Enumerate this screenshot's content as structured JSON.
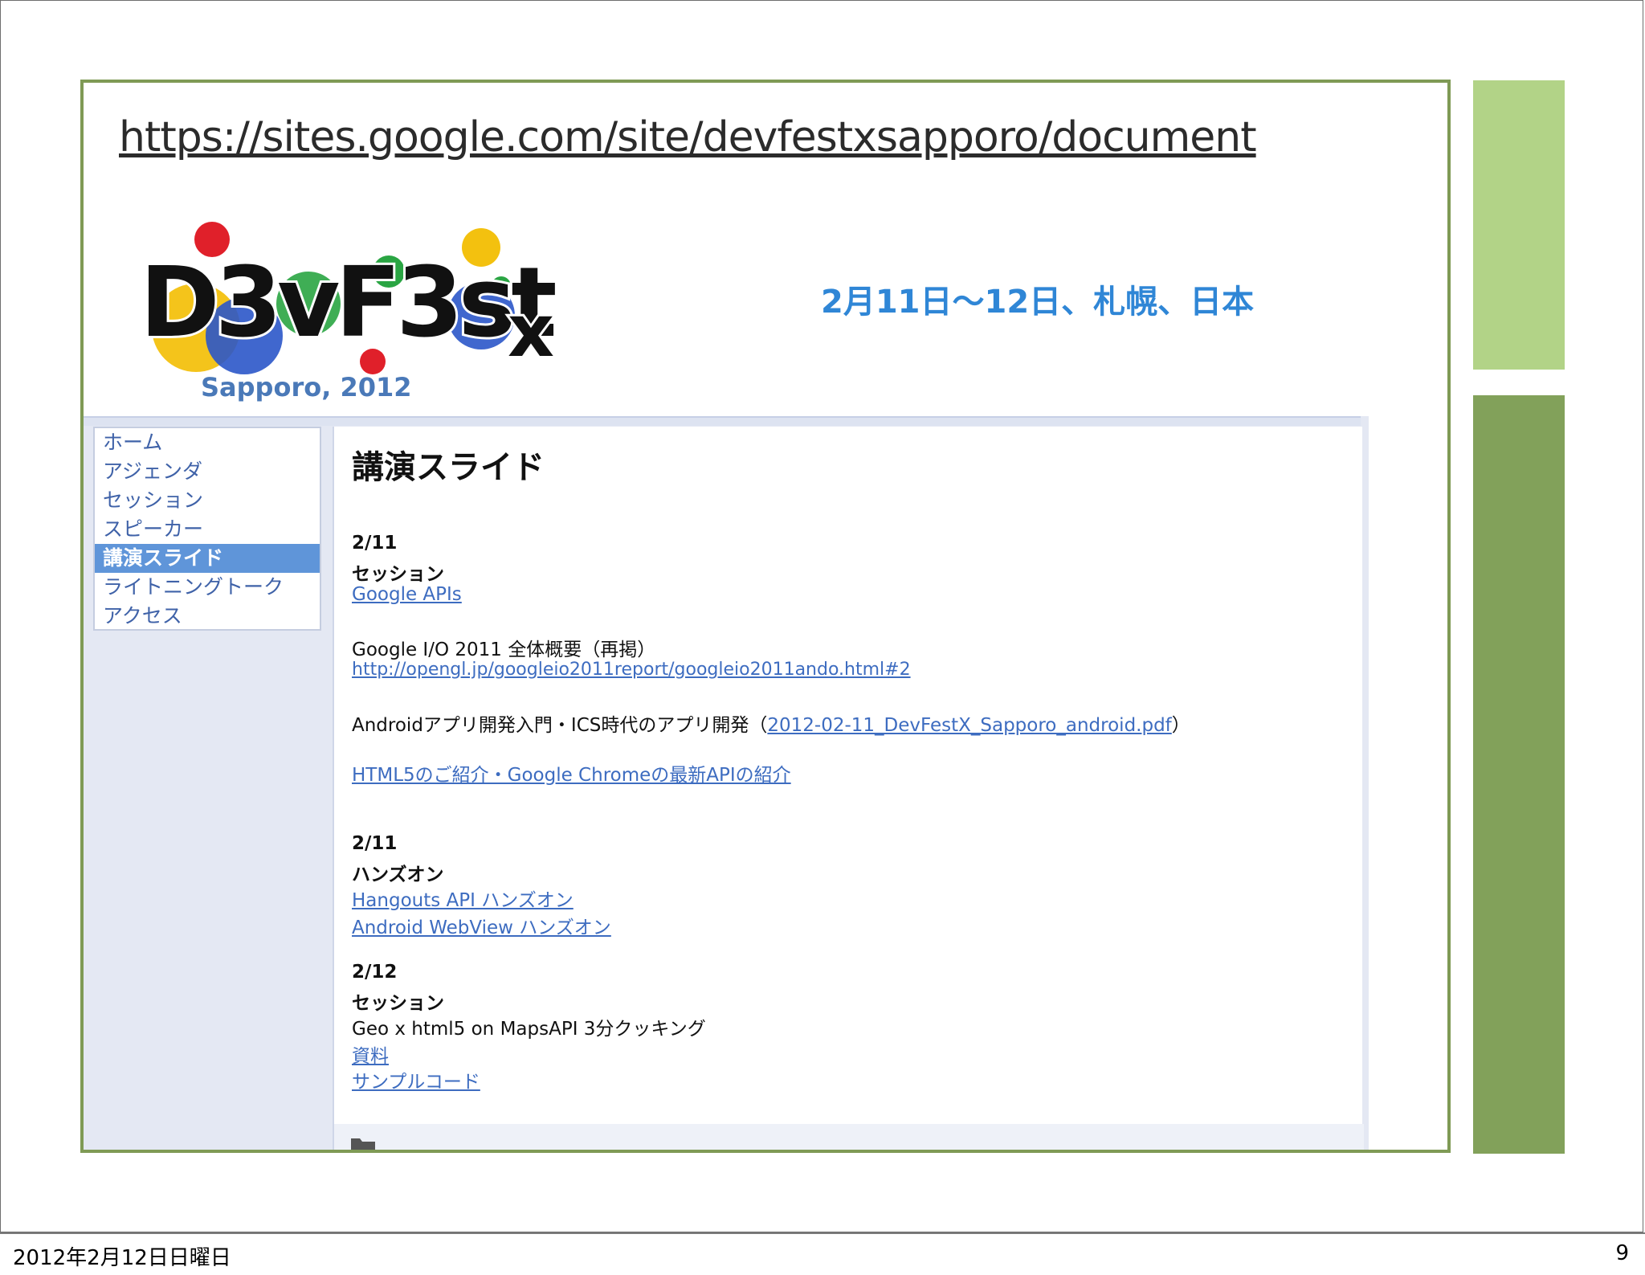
{
  "slide": {
    "url_title": "https://sites.google.com/site/devfestxsapporo/document",
    "footer_date": "2012年2月12日日曜日",
    "page_number": "9",
    "accent_light": "#b2d387",
    "accent_dark": "#82a15a"
  },
  "site": {
    "logo_text": "D3vF3st",
    "logo_x": "x",
    "logo_subtitle": "Sapporo, 2012",
    "event_date": "2月11日〜12日、札幌、日本",
    "nav": [
      {
        "label": "ホーム",
        "active": false
      },
      {
        "label": "アジェンダ",
        "active": false
      },
      {
        "label": "セッション",
        "active": false
      },
      {
        "label": "スピーカー",
        "active": false
      },
      {
        "label": "講演スライド",
        "active": true
      },
      {
        "label": "ライトニングトーク",
        "active": false
      },
      {
        "label": "アクセス",
        "active": false
      }
    ],
    "page_heading": "講演スライド",
    "sections": {
      "s1_date": "2/11",
      "s1_type": "セッション",
      "s1_link": "Google APIs",
      "s1_io_title": "Google I/O 2011 全体概要（再掲）",
      "s1_io_link": "http://opengl.jp/googleio2011report/googleio2011ando.html#2",
      "s1_android_title": "Androidアプリ開発入門・ICS時代のアプリ開発（",
      "s1_android_link": "2012-02-11_DevFestX_Sapporo_android.pdf",
      "s1_android_close": "）",
      "s1_html5_link": "HTML5のご紹介・Google Chromeの最新APIの紹介",
      "s2_date": "2/11",
      "s2_type": "ハンズオン",
      "s2_link1": "Hangouts API ハンズオン",
      "s2_link2": "Android WebView ハンズオン",
      "s3_date": "2/12",
      "s3_type": "セッション",
      "s3_title": "Geo x html5 on MapsAPI 3分クッキング",
      "s3_link1": "資料",
      "s3_link2": "サンプルコード"
    }
  }
}
